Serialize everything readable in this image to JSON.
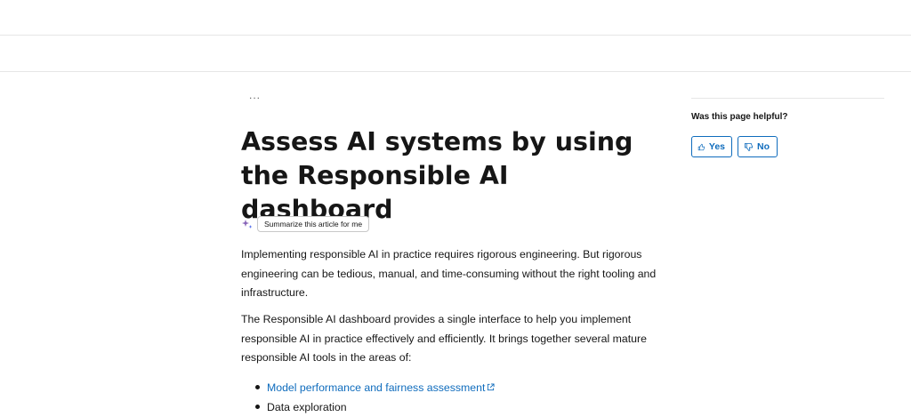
{
  "breadcrumb": {
    "more": "..."
  },
  "article": {
    "title": "Assess AI systems by using the Responsible AI dashboard",
    "summarize_label": "Summarize this article for me",
    "paragraphs": [
      "Implementing responsible AI in practice requires rigorous engineering. But rigorous engineering can be tedious, manual, and time-consuming without the right tooling and infrastructure.",
      "The Responsible AI dashboard provides a single interface to help you implement responsible AI in practice effectively and efficiently. It brings together several mature responsible AI tools in the areas of:"
    ],
    "bullets": [
      {
        "text": "Model performance and fairness assessment",
        "external": true
      },
      {
        "text": "Data exploration",
        "external": false
      }
    ]
  },
  "feedback": {
    "question": "Was this page helpful?",
    "yes_label": "Yes",
    "no_label": "No"
  },
  "colors": {
    "link": "#0f6cbd",
    "text": "#161616",
    "divider": "#e6e6e6",
    "sparkle": "#8764b8"
  },
  "icons": {
    "summarize": "sparkle-icon",
    "yes": "thumbs-up-icon",
    "no": "thumbs-down-icon",
    "external": "external-link-icon"
  }
}
